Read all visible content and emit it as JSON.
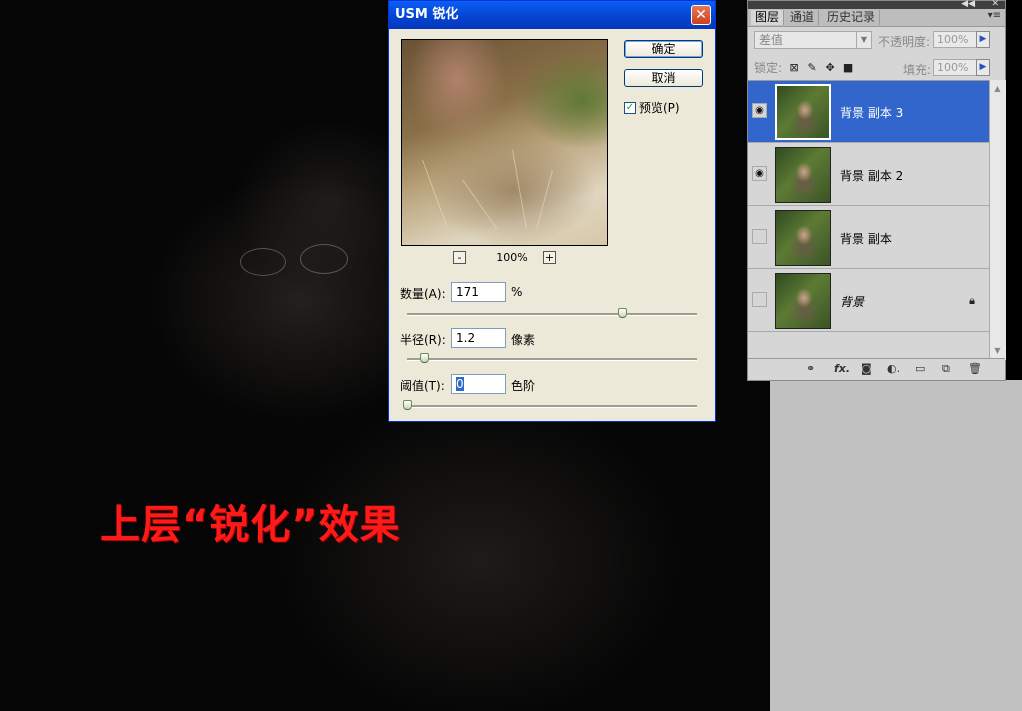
{
  "caption": "上层“锐化”效果",
  "dialog": {
    "title": "USM 锐化",
    "close_glyph": "✕",
    "ok_label": "确定",
    "cancel_label": "取消",
    "preview_label": "预览(P)",
    "preview_checked": true,
    "zoom_out": "-",
    "zoom_in": "+",
    "zoom_value": "100%",
    "amount": {
      "label": "数量(A):",
      "value": "171",
      "unit": "%",
      "slider": 0.74
    },
    "radius": {
      "label": "半径(R):",
      "value": "1.2",
      "unit": "像素",
      "slider": 0.06
    },
    "threshold": {
      "label": "阈值(T):",
      "value": "0",
      "unit": "色阶",
      "slider": 0.0
    }
  },
  "layers_panel": {
    "tabs": [
      "图层",
      "通道",
      "历史记录"
    ],
    "active_tab": "图层",
    "blend_mode": "差值",
    "opacity_label": "不透明度:",
    "opacity_value": "100%",
    "lock_label": "锁定:",
    "fill_label": "填充:",
    "fill_value": "100%",
    "layers": [
      {
        "name": "背景 副本 3",
        "visible": true,
        "selected": true
      },
      {
        "name": "背景 副本 2",
        "visible": true,
        "selected": false
      },
      {
        "name": "背景 副本",
        "visible": false,
        "selected": false
      },
      {
        "name": "背景",
        "visible": false,
        "selected": false,
        "locked": true,
        "italic": true
      }
    ],
    "icons": [
      "link-icon",
      "fx-icon",
      "mask-icon",
      "adjustment-icon",
      "folder-icon",
      "new-layer-icon",
      "trash-icon"
    ]
  },
  "colors": {
    "caption": "#ff1a1a",
    "selection": "#3366cc",
    "dialog_title": "#0443d0"
  }
}
